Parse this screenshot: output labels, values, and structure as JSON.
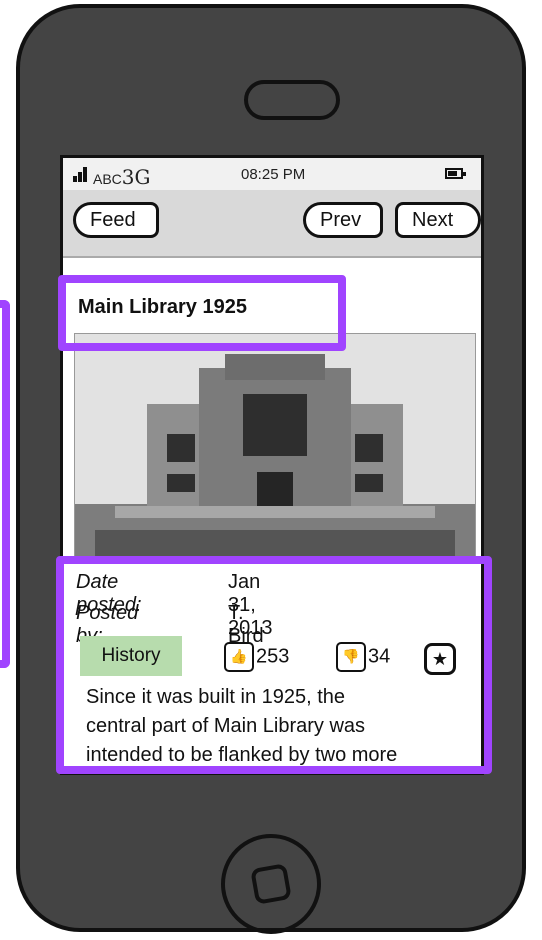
{
  "status": {
    "carrier": "ABC",
    "network": "3G",
    "time": "08:25 PM"
  },
  "nav": {
    "back_label": "Feed",
    "prev_label": "Prev",
    "next_label": "Next"
  },
  "post": {
    "title": "Main Library 1925",
    "date_key": "Date posted:",
    "date_value": "Jan 31, 2013",
    "by_key": "Posted by:",
    "by_value": "T. Bird",
    "tag": "History",
    "likes": "253",
    "dislikes": "34",
    "text": [
      "Since it was built in 1925, the",
      "central part of Main Library was",
      "intended to be flanked by two more"
    ]
  },
  "colors": {
    "highlight": "#a044ff",
    "tag_bg": "#b7dcad",
    "phone": "#444444"
  },
  "icons": {
    "like": "thumbs-up-icon",
    "dislike": "thumbs-down-icon",
    "favorite": "star-icon"
  }
}
